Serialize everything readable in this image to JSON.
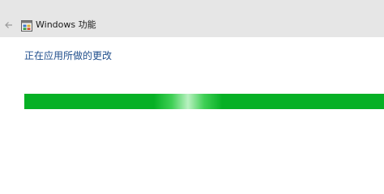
{
  "window": {
    "title": "Windows 功能",
    "back_icon": "back-arrow-icon",
    "app_icon": "windows-features-icon"
  },
  "main": {
    "status_text": "正在应用所做的更改",
    "progress": {
      "percent": 100,
      "color": "#06b025"
    }
  },
  "colors": {
    "titlebar_bg": "#e6e6e6",
    "status_text": "#1f4e8c",
    "progress_green": "#06b025"
  }
}
